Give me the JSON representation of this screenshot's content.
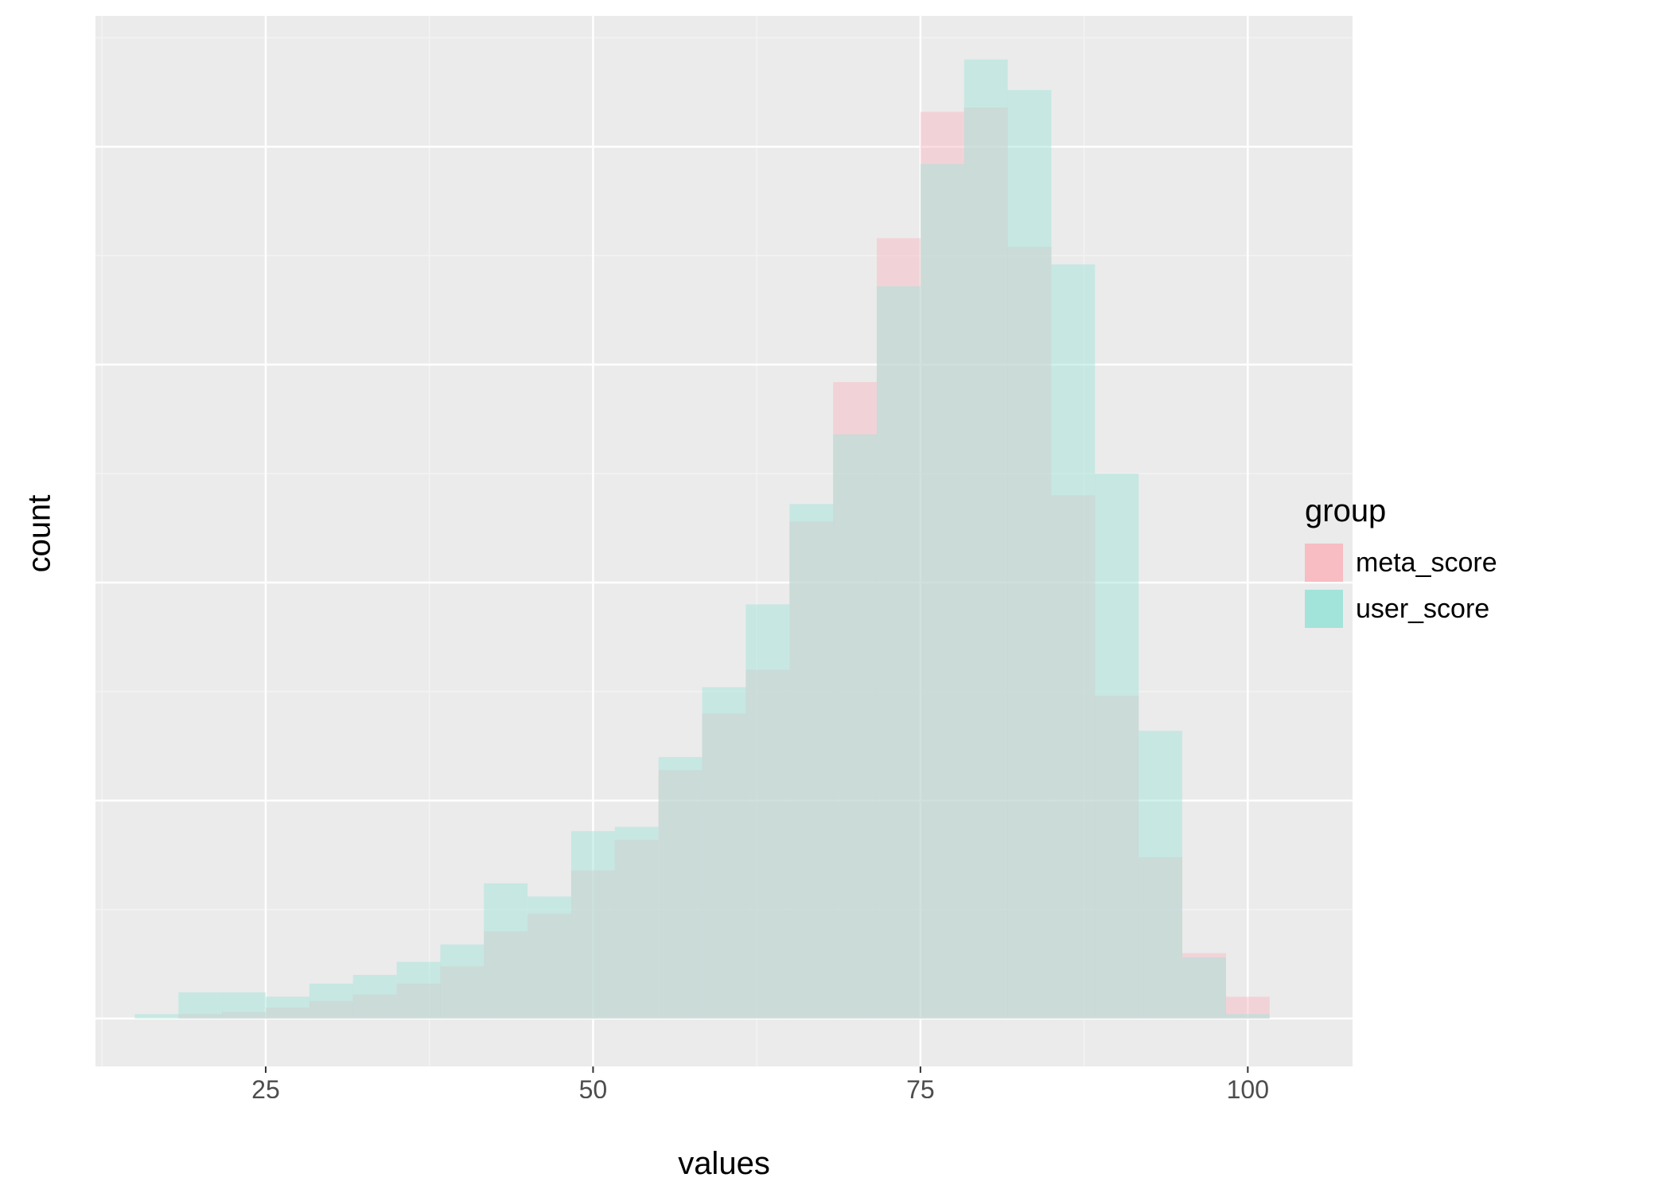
{
  "chart_data": {
    "type": "bar",
    "xlabel": "values",
    "ylabel": "count",
    "xlim": [
      12,
      108
    ],
    "ylim": [
      -110,
      2300
    ],
    "x_breaks": [
      25,
      50,
      75,
      100
    ],
    "y_breaks": [
      0,
      500,
      1000,
      1500,
      2000
    ],
    "bin_width": 3.333,
    "series": [
      {
        "name": "meta_score",
        "color": "#F8BCC3",
        "alpha": 0.5,
        "bins": [
          {
            "x": 16.67,
            "count": 0
          },
          {
            "x": 20.0,
            "count": 10
          },
          {
            "x": 23.33,
            "count": 15
          },
          {
            "x": 26.67,
            "count": 25
          },
          {
            "x": 30.0,
            "count": 40
          },
          {
            "x": 33.33,
            "count": 55
          },
          {
            "x": 36.67,
            "count": 80
          },
          {
            "x": 40.0,
            "count": 120
          },
          {
            "x": 43.33,
            "count": 200
          },
          {
            "x": 46.67,
            "count": 240
          },
          {
            "x": 50.0,
            "count": 340
          },
          {
            "x": 53.33,
            "count": 410
          },
          {
            "x": 56.67,
            "count": 570
          },
          {
            "x": 60.0,
            "count": 700
          },
          {
            "x": 63.33,
            "count": 800
          },
          {
            "x": 66.67,
            "count": 1140
          },
          {
            "x": 70.0,
            "count": 1460
          },
          {
            "x": 73.33,
            "count": 1790
          },
          {
            "x": 76.67,
            "count": 2080
          },
          {
            "x": 80.0,
            "count": 2090
          },
          {
            "x": 83.33,
            "count": 1770
          },
          {
            "x": 86.67,
            "count": 1200
          },
          {
            "x": 90.0,
            "count": 740
          },
          {
            "x": 93.33,
            "count": 370
          },
          {
            "x": 96.67,
            "count": 150
          },
          {
            "x": 100.0,
            "count": 50
          },
          {
            "x": 103.33,
            "count": 0
          }
        ]
      },
      {
        "name": "user_score",
        "color": "#A3E4DA",
        "alpha": 0.5,
        "bins": [
          {
            "x": 16.67,
            "count": 10
          },
          {
            "x": 20.0,
            "count": 60
          },
          {
            "x": 23.33,
            "count": 60
          },
          {
            "x": 26.67,
            "count": 50
          },
          {
            "x": 30.0,
            "count": 80
          },
          {
            "x": 33.33,
            "count": 100
          },
          {
            "x": 36.67,
            "count": 130
          },
          {
            "x": 40.0,
            "count": 170
          },
          {
            "x": 43.33,
            "count": 310
          },
          {
            "x": 46.67,
            "count": 280
          },
          {
            "x": 50.0,
            "count": 430
          },
          {
            "x": 53.33,
            "count": 440
          },
          {
            "x": 56.67,
            "count": 600
          },
          {
            "x": 60.0,
            "count": 760
          },
          {
            "x": 63.33,
            "count": 950
          },
          {
            "x": 66.67,
            "count": 1180
          },
          {
            "x": 70.0,
            "count": 1340
          },
          {
            "x": 73.33,
            "count": 1680
          },
          {
            "x": 76.67,
            "count": 1960
          },
          {
            "x": 80.0,
            "count": 2200
          },
          {
            "x": 83.33,
            "count": 2130
          },
          {
            "x": 86.67,
            "count": 1730
          },
          {
            "x": 90.0,
            "count": 1250
          },
          {
            "x": 93.33,
            "count": 660
          },
          {
            "x": 96.67,
            "count": 140
          },
          {
            "x": 100.0,
            "count": 10
          },
          {
            "x": 103.33,
            "count": 0
          }
        ]
      }
    ]
  },
  "legend": {
    "title": "group",
    "items": [
      {
        "label": "meta_score",
        "color": "#F8BCC3"
      },
      {
        "label": "user_score",
        "color": "#A3E4DA"
      }
    ]
  }
}
